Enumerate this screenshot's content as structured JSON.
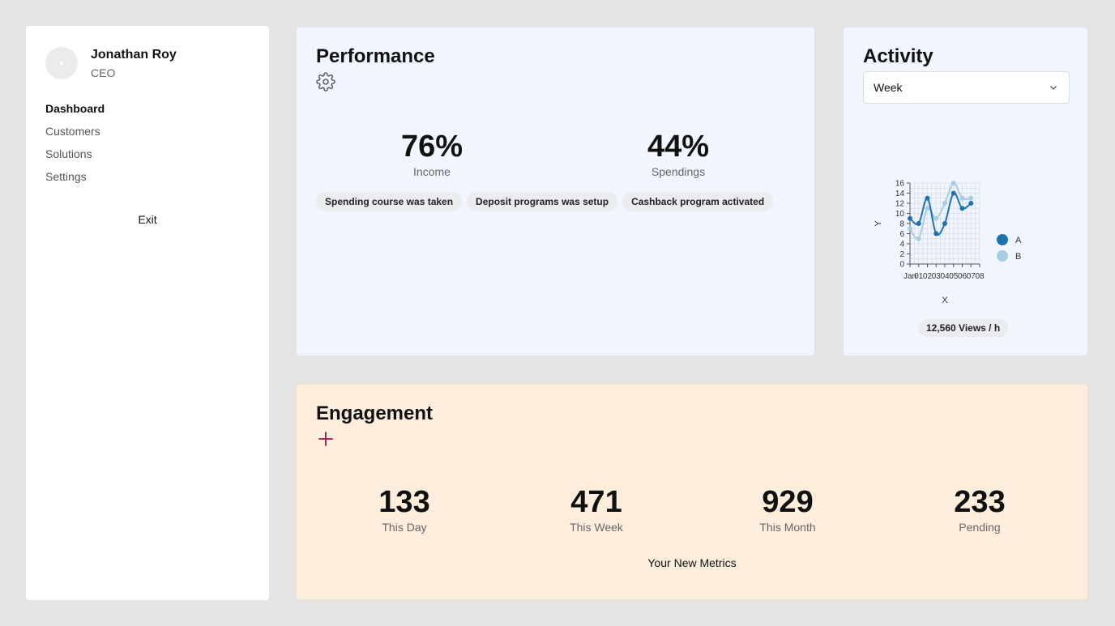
{
  "user": {
    "name": "Jonathan Roy",
    "role": "CEO"
  },
  "nav": {
    "items": [
      {
        "label": "Dashboard",
        "active": true
      },
      {
        "label": "Customers",
        "active": false
      },
      {
        "label": "Solutions",
        "active": false
      },
      {
        "label": "Settings",
        "active": false
      }
    ],
    "exit_label": "Exit"
  },
  "performance": {
    "title": "Performance",
    "settings_icon": "gear-icon",
    "stats": [
      {
        "value": "76%",
        "label": "Income"
      },
      {
        "value": "44%",
        "label": "Spendings"
      }
    ],
    "tags": [
      "Spending course was taken",
      "Deposit programs was setup",
      "Cashback program activated"
    ]
  },
  "activity": {
    "title": "Activity",
    "period_select": {
      "value": "Week"
    },
    "views": "12,560 Views / h"
  },
  "engagement": {
    "title": "Engagement",
    "add_icon": "plus-icon",
    "stats": [
      {
        "value": "133",
        "label": "This Day"
      },
      {
        "value": "471",
        "label": "This Week"
      },
      {
        "value": "929",
        "label": "This Month"
      },
      {
        "value": "233",
        "label": "Pending"
      }
    ],
    "footer": "Your New Metrics"
  },
  "colors": {
    "series_a": "#1f72b0",
    "series_b": "#a6cde2",
    "accent_plus": "#a0144a"
  },
  "chart_data": {
    "type": "line",
    "x": [
      "Jan",
      "01",
      "02",
      "03",
      "04",
      "05",
      "06",
      "07",
      "08"
    ],
    "series": [
      {
        "name": "A",
        "values": [
          9,
          8,
          13,
          6,
          8,
          14,
          11,
          12
        ]
      },
      {
        "name": "B",
        "values": [
          7,
          5,
          11,
          9,
          12,
          16,
          13,
          13
        ]
      }
    ],
    "xlabel": "X",
    "ylabel": "Y",
    "ylim": [
      0,
      16
    ],
    "yticks": [
      0,
      2,
      4,
      6,
      8,
      10,
      12,
      14,
      16
    ],
    "grid": true,
    "legend": "right"
  }
}
